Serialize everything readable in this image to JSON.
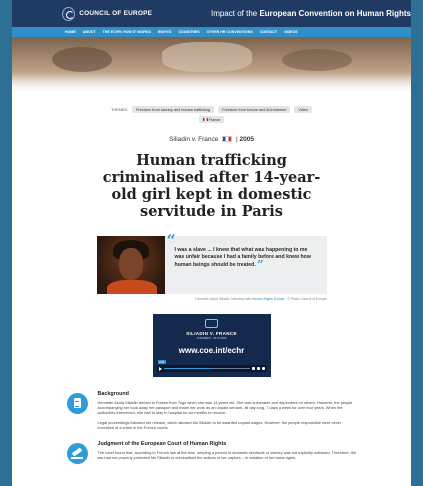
{
  "header": {
    "brand": "COUNCIL OF EUROPE",
    "site_title_prefix": "Impact of the ",
    "site_title_bold": "European Convention on Human Rights"
  },
  "nav": {
    "items": [
      "HOME",
      "ABOUT",
      "THE ECHR: HOW IT WORKS",
      "RIGHTS",
      "COUNTRIES",
      "OTHER HR CONVENTIONS",
      "CONTACT",
      "VIDEOS"
    ]
  },
  "themes": {
    "label": "THEMES:",
    "chips": [
      "Freedom from slavery and human trafficking",
      "Freedom from torture and ill-treatment",
      "Video"
    ],
    "country": "France"
  },
  "case": {
    "name": "Siliadin v. France",
    "separator": "|",
    "year": "2005"
  },
  "title": "Human trafficking criminalised after 14-year-old girl kept in domestic servitude in Paris",
  "quote": {
    "text": "I was a slave ... I knew that what was happening to me was unfair because I had a family before and knew how human beings should be treated.",
    "caption_prefix": "Henriette Akofa Siliadin, interview with ",
    "caption_link": "Human Rights Europe",
    "caption_suffix": " - © Photo Council of Europe"
  },
  "video": {
    "title": "SILIADIN V. FRANCE",
    "subtitle": "JUDGMENT · 26.07.2005",
    "url": "www.coe.int/echr",
    "badge": "LIVE",
    "progress": 0.55
  },
  "sections": [
    {
      "heading": "Background",
      "icon": "document-icon",
      "paragraphs": [
        "Henriette Akofa Siliadin arrived in France from Togo when she was 14 years old. She was vulnerable and dependent on others. However, the people accompanying her took away her passport and made her work as an unpaid servant, all day long, 7 days a week for over four years. When the authorities intervened, she had to stay in hospital for six months to recover.",
        "Legal proceedings followed her release, which allowed Ms Siliadin to be awarded unpaid wages. However, the people responsible were never convicted of a crime in the French courts."
      ]
    },
    {
      "heading": "Judgment of the European Court of Human Rights",
      "icon": "gavel-icon",
      "paragraphs": [
        "The court found that, according to French law at the time, keeping a person in domestic servitude or slavery was not explicitly outlawed. Therefore, the law had not properly protected Ms Siliadin or criminalised the actions of her captors – in violation of her basic rights."
      ]
    }
  ],
  "colors": {
    "header_bg": "#1f3a63",
    "nav_bg": "#2f8fc9",
    "accent": "#2f9cd9",
    "page_border": "#2e6f96"
  }
}
